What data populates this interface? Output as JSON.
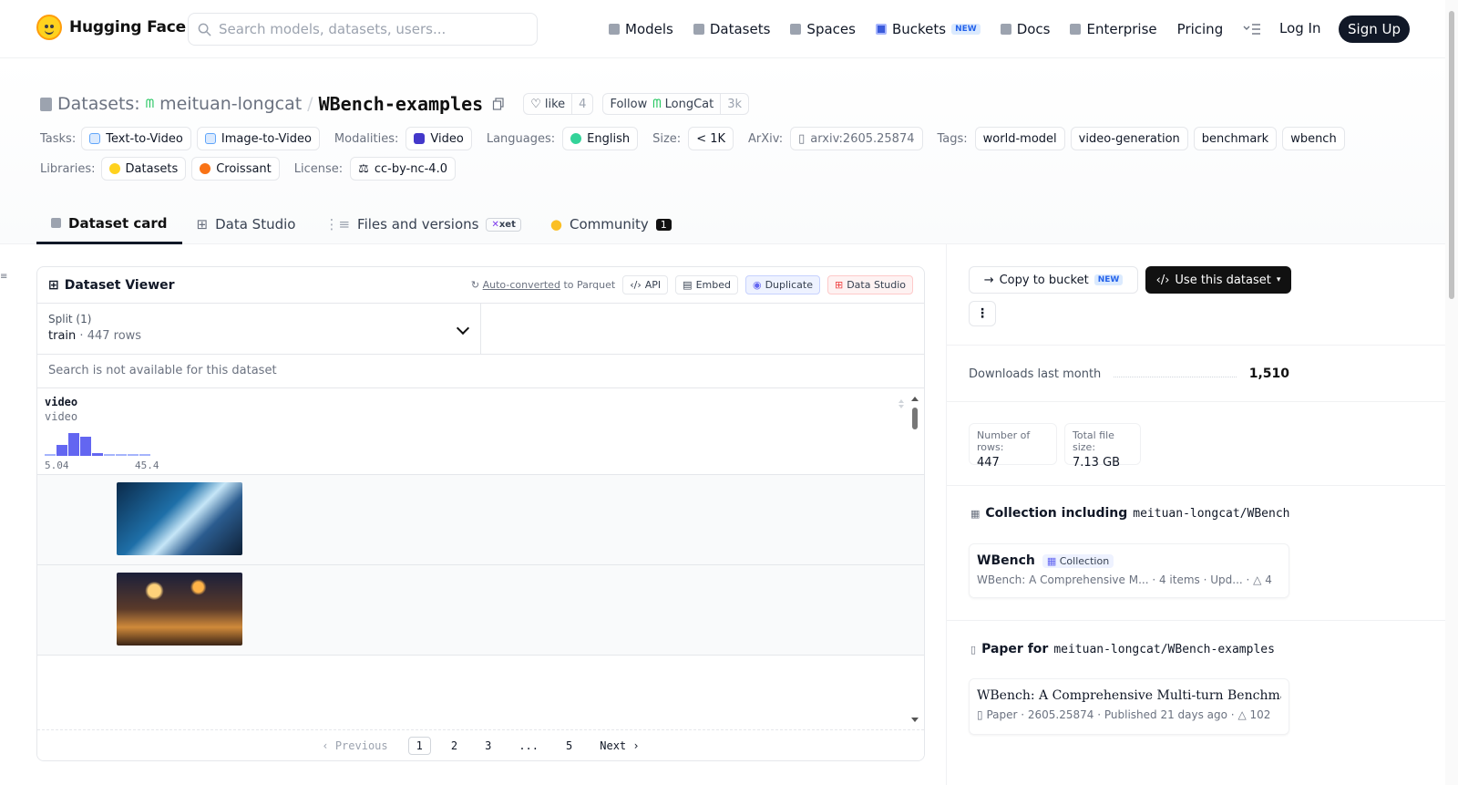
{
  "brand": {
    "name": "Hugging Face"
  },
  "search": {
    "placeholder": "Search models, datasets, users..."
  },
  "nav": {
    "models": "Models",
    "datasets": "Datasets",
    "spaces": "Spaces",
    "buckets": "Buckets",
    "buckets_badge": "NEW",
    "docs": "Docs",
    "enterprise": "Enterprise",
    "pricing": "Pricing",
    "login": "Log In",
    "signup": "Sign Up"
  },
  "repo": {
    "kind": "Datasets:",
    "org": "meituan-longcat",
    "sep": "/",
    "name": "WBench-examples",
    "like_label": "like",
    "like_count": "4",
    "follow_label": "Follow",
    "follow_org": "LongCat",
    "follow_count": "3k"
  },
  "meta": {
    "tasks_label": "Tasks:",
    "task1": "Text-to-Video",
    "task2": "Image-to-Video",
    "modalities_label": "Modalities:",
    "modality": "Video",
    "languages_label": "Languages:",
    "language": "English",
    "size_label": "Size:",
    "size": "< 1K",
    "arxiv_label": "ArXiv:",
    "arxiv": "arxiv:2605.25874",
    "tags_label": "Tags:",
    "tags": [
      "world-model",
      "video-generation",
      "benchmark",
      "wbench"
    ],
    "libraries_label": "Libraries:",
    "lib1": "Datasets",
    "lib2": "Croissant",
    "license_label": "License:",
    "license": "cc-by-nc-4.0"
  },
  "tabs": {
    "card": "Dataset card",
    "studio": "Data Studio",
    "files": "Files and versions",
    "xet": "xet",
    "community": "Community",
    "community_count": "1"
  },
  "viewer": {
    "title": "Dataset Viewer",
    "autoconv": "Auto-converted",
    "autoconv_rest": "to Parquet",
    "api": "API",
    "embed": "Embed",
    "duplicate": "Duplicate",
    "data_studio": "Data Studio",
    "split_label": "Split (1)",
    "split_name": "train",
    "split_dot": "·",
    "split_rows": "447 rows",
    "search_note": "Search is not available for this dataset",
    "column_name": "video",
    "column_type": "video",
    "hist_min": "5.04",
    "hist_max": "45.4",
    "hist_values": [
      0.05,
      0.45,
      0.95,
      0.8,
      0.1,
      0.05,
      0.05,
      0.05,
      0.05
    ]
  },
  "pager": {
    "prev": "Previous",
    "p1": "1",
    "p2": "2",
    "p3": "3",
    "ellipsis": "...",
    "p5": "5",
    "next": "Next"
  },
  "sidebar": {
    "copy": "Copy to bucket",
    "copy_badge": "NEW",
    "use": "Use this dataset",
    "downloads_label": "Downloads last month",
    "downloads": "1,510",
    "rows_label": "Number of rows:",
    "rows": "447",
    "filesize_label": "Total file size:",
    "filesize": "7.13 GB",
    "collection_heading": "Collection including",
    "collection_repo": "meituan-longcat/WBench-e...",
    "coll_title": "WBench",
    "coll_badge": "Collection",
    "coll_desc": "WBench: A Comprehensive M...",
    "coll_items": "4 items",
    "coll_upd": "Upd...",
    "coll_likes": "4",
    "paper_heading": "Paper for",
    "paper_repo": "meituan-longcat/WBench-examples",
    "paper_title": "WBench: A Comprehensive Multi-turn Benchmark...",
    "paper_kind": "Paper",
    "paper_id": "2605.25874",
    "paper_pub": "Published 21 days ago",
    "paper_likes": "102"
  },
  "colors": {
    "accent": "#111827",
    "histogram": "#6366f1"
  }
}
